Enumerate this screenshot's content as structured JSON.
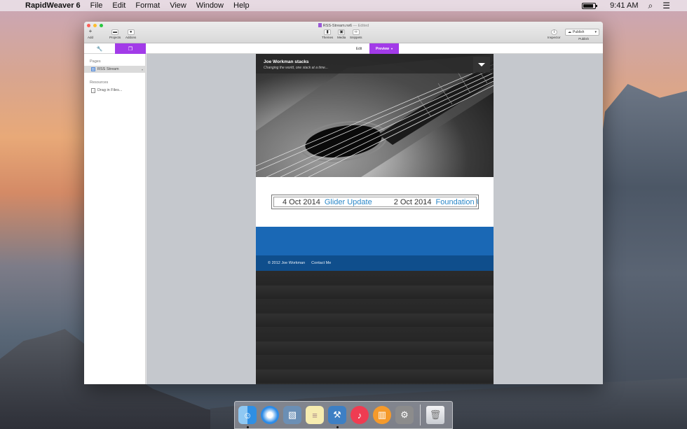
{
  "menubar": {
    "app_name": "RapidWeaver 6",
    "menus": [
      "File",
      "Edit",
      "Format",
      "View",
      "Window",
      "Help"
    ],
    "clock": "9:41 AM"
  },
  "window": {
    "doc_title": "RSS-Stream.rw6",
    "edited": "— Edited",
    "toolbar": {
      "add": "Add",
      "projects": "Projects",
      "addons": "Addons",
      "themes": "Themes",
      "media": "Media",
      "snippets": "Snippets",
      "inspector": "Inspector",
      "publish_button": "Publish",
      "publish_label": "Publish"
    },
    "modes": {
      "edit": "Edit",
      "preview": "Preview"
    }
  },
  "sidebar": {
    "pages_heading": "Pages",
    "pages": [
      {
        "label": "RSS Stream"
      }
    ],
    "resources_heading": "Resources",
    "resources": [
      {
        "label": "Drag in Files..."
      }
    ]
  },
  "preview": {
    "site_title": "Joe Workman stacks",
    "site_subtitle": "Changing the world, one stack at a time...",
    "feed": [
      {
        "date": "4 Oct 2014",
        "title": "Glider Update"
      },
      {
        "date": "2 Oct 2014",
        "title": "Foundation Updates"
      }
    ],
    "footer": {
      "copyright": "© 2012 Joe Workman",
      "contact": "Contact Me"
    }
  },
  "dock": [
    "Finder",
    "Safari",
    "Preview",
    "Notes",
    "Xcode",
    "iTunes",
    "iBooks",
    "System Preferences",
    "Trash"
  ],
  "colors": {
    "accent": "#a23be8",
    "link": "#2a87c8",
    "band": "#1a68b5",
    "footer": "#0f4e8c"
  }
}
